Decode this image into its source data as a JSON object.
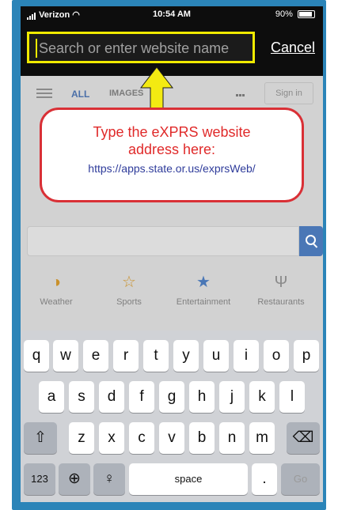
{
  "status": {
    "carrier": "Verizon",
    "time": "10:54 AM",
    "battery": "90%"
  },
  "search": {
    "placeholder": "Search or enter website name",
    "cancel_label": "Cancel"
  },
  "google": {
    "tabs": [
      "ALL",
      "IMAGES"
    ],
    "sign_in": "Sign in",
    "shortcuts": [
      {
        "label": "Weather",
        "icon": "weather-icon"
      },
      {
        "label": "Sports",
        "icon": "trophy-icon"
      },
      {
        "label": "Entertainment",
        "icon": "star-icon"
      },
      {
        "label": "Restaurants",
        "icon": "fork-knife-icon"
      }
    ]
  },
  "callout": {
    "line1": "Type the eXPRS website",
    "line2": "address here:",
    "url": "https://apps.state.or.us/exprsWeb/"
  },
  "keyboard": {
    "row1": [
      "q",
      "w",
      "e",
      "r",
      "t",
      "y",
      "u",
      "i",
      "o",
      "p"
    ],
    "row2": [
      "a",
      "s",
      "d",
      "f",
      "g",
      "h",
      "j",
      "k",
      "l"
    ],
    "row3": [
      "z",
      "x",
      "c",
      "v",
      "b",
      "n",
      "m"
    ],
    "numbers_label": "123",
    "space_label": "space",
    "period_label": ".",
    "go_label": "Go"
  },
  "colors": {
    "highlight": "#f0ea00",
    "callout_border": "#d93036",
    "callout_text": "#e02a2a",
    "url_text": "#2f3c9b",
    "frame": "#2b84b8"
  }
}
